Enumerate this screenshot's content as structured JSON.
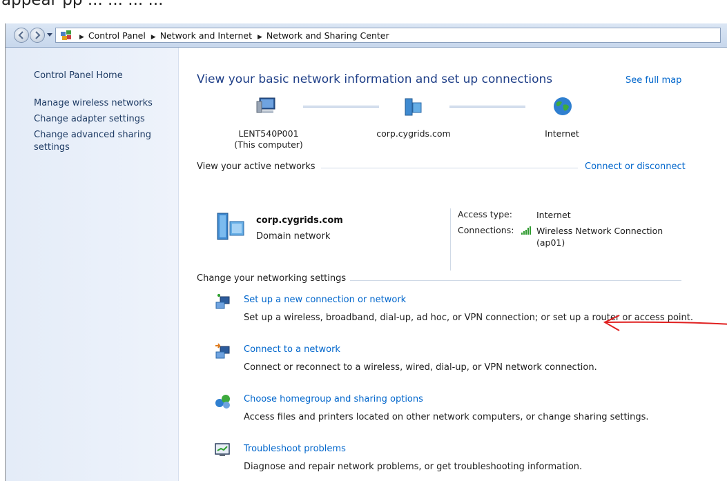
{
  "overlay_text": "appear pp ... ... ... ...",
  "address_bar": {
    "crumbs": [
      "Control Panel",
      "Network and Internet",
      "Network and Sharing Center"
    ]
  },
  "sidebar": {
    "items": [
      {
        "label": "Control Panel Home"
      },
      {
        "label": "Manage wireless networks"
      },
      {
        "label": "Change adapter settings"
      },
      {
        "label": "Change advanced sharing settings"
      }
    ]
  },
  "main": {
    "title": "View your basic network information and set up connections",
    "see_full_map": "See full map",
    "map": {
      "computer": {
        "name": "LENT540P001",
        "sub": "(This computer)"
      },
      "domain": {
        "name": "corp.cygrids.com"
      },
      "internet": {
        "name": "Internet"
      }
    },
    "active_networks": {
      "heading": "View your active networks",
      "connect_link": "Connect or disconnect",
      "network_name": "corp.cygrids.com",
      "network_type": "Domain network",
      "access_type_label": "Access type:",
      "access_type_value": "Internet",
      "connections_label": "Connections:",
      "connection_line1": "Wireless Network Connection",
      "connection_line2": "(ap01)"
    },
    "settings": {
      "heading": "Change your networking settings",
      "tasks": [
        {
          "link": "Set up a new connection or network",
          "desc": "Set up a wireless, broadband, dial-up, ad hoc, or VPN connection; or set up a router or access point.",
          "icon": "new-connection-icon"
        },
        {
          "link": "Connect to a network",
          "desc": "Connect or reconnect to a wireless, wired, dial-up, or VPN network connection.",
          "icon": "connect-network-icon"
        },
        {
          "link": "Choose homegroup and sharing options",
          "desc": "Access files and printers located on other network computers, or change sharing settings.",
          "icon": "homegroup-icon"
        },
        {
          "link": "Troubleshoot problems",
          "desc": "Diagnose and repair network problems, or get troubleshooting information.",
          "icon": "troubleshoot-icon"
        }
      ]
    }
  },
  "colors": {
    "link": "#0066cc",
    "title": "#1e3e87",
    "annotation_arrow": "#e02020"
  }
}
